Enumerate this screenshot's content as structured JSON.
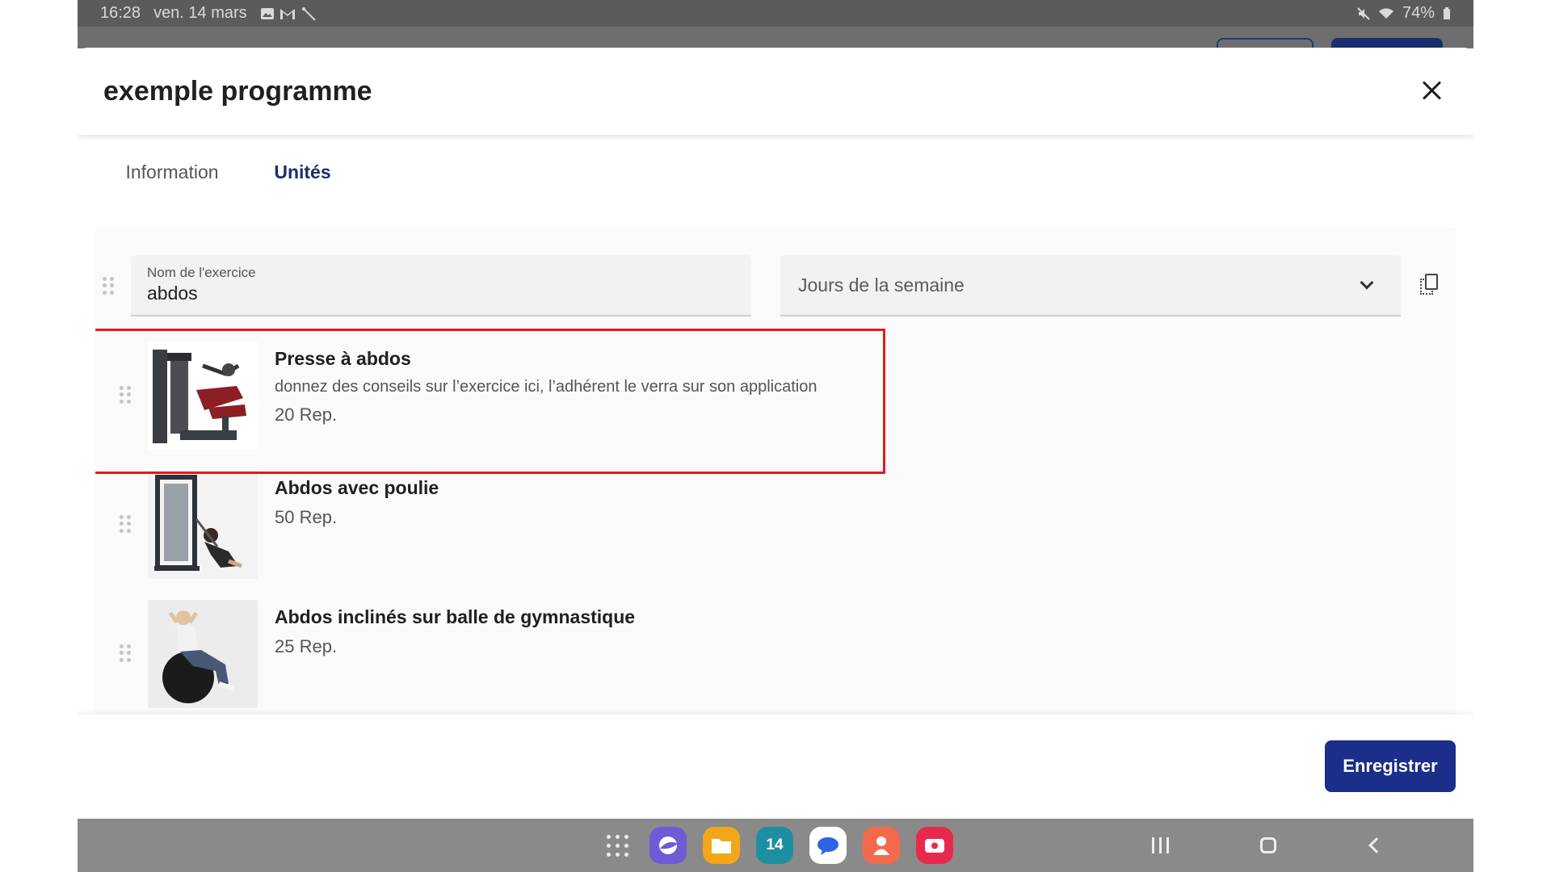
{
  "status_bar": {
    "time": "16:28",
    "date": "ven. 14 mars",
    "battery": "74%"
  },
  "modal": {
    "title": "exemple programme"
  },
  "tabs": [
    {
      "label": "Information",
      "active": false
    },
    {
      "label": "Unités",
      "active": true
    }
  ],
  "exercise_form": {
    "name_label": "Nom de l'exercice",
    "name_value": "abdos",
    "days_placeholder": "Jours de la semaine"
  },
  "exercises": [
    {
      "title": "Presse à abdos",
      "description": "donnez des conseils sur l’exercice ici, l’adhérent le verra sur son application",
      "reps": "20 Rep.",
      "image_icon": "ab-crunch-machine-image"
    },
    {
      "title": "Abdos avec poulie",
      "description": "",
      "reps": "50 Rep.",
      "image_icon": "cable-crunch-image"
    },
    {
      "title": "Abdos inclinés sur balle de gymnastique",
      "description": "",
      "reps": "25 Rep.",
      "image_icon": "gym-ball-crunch-image"
    }
  ],
  "footer": {
    "save_label": "Enregistrer"
  },
  "dock": {
    "calendar_day": "14"
  },
  "colors": {
    "primary": "#1a2e8a",
    "tab_active": "#1a2e6b",
    "highlight": "#e31b1b"
  }
}
